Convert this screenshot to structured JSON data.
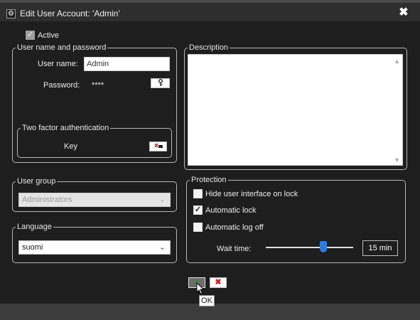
{
  "window": {
    "title": "Edit User Account: 'Admin'",
    "close_glyph": "✖",
    "icon": "settings-gear-icon"
  },
  "active": {
    "label": "Active",
    "checked": true
  },
  "credentials": {
    "legend": "User name and password",
    "username_label": "User name:",
    "username_value": "Admin",
    "password_label": "Password:",
    "password_value": "****",
    "password_button_icon": "key-icon"
  },
  "twofa": {
    "legend": "Two factor authentication",
    "key_label": "Key",
    "key_button_icon": "key-clear-icon"
  },
  "description": {
    "legend": "Description",
    "value": ""
  },
  "user_group": {
    "legend": "User group",
    "selected": "Administrators"
  },
  "language": {
    "legend": "Language",
    "selected": "suomi"
  },
  "protection": {
    "legend": "Protection",
    "options": [
      {
        "label": "Hide user interface on lock",
        "checked": false
      },
      {
        "label": "Automatic lock",
        "checked": true
      },
      {
        "label": "Automatic log off",
        "checked": false
      }
    ],
    "wait_time_label": "Wait time:",
    "wait_time_value": "15 min",
    "wait_time_slider_fraction": 0.66
  },
  "buttons": {
    "ok_glyph": "✔",
    "cancel_glyph": "✖",
    "ok_tooltip": "OK"
  },
  "colors": {
    "accent": "#2c7be5",
    "background": "#1e1e1e",
    "ok": "#2f8f2f",
    "cancel": "#d02020"
  }
}
